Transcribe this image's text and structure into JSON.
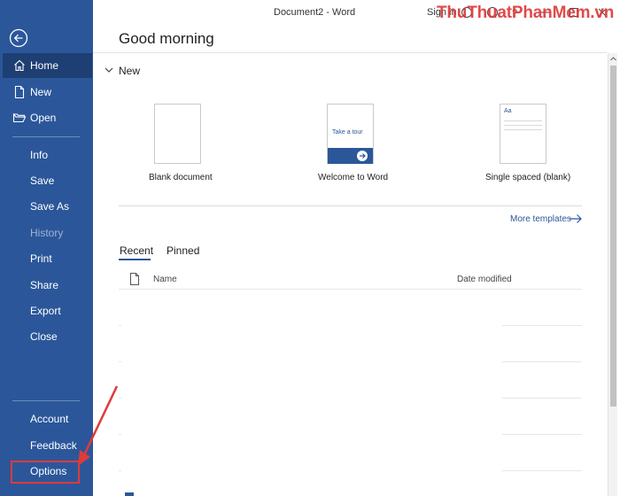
{
  "window": {
    "title": "Document2  -  Word",
    "sign_in": "Sign in",
    "watermark": "ThuThuatPhanMem.vn"
  },
  "sidebar": {
    "items": [
      {
        "label": "Home",
        "icon": "home-icon"
      },
      {
        "label": "New",
        "icon": "new-document-icon"
      },
      {
        "label": "Open",
        "icon": "open-folder-icon"
      },
      {
        "label": "Info"
      },
      {
        "label": "Save"
      },
      {
        "label": "Save As"
      },
      {
        "label": "History"
      },
      {
        "label": "Print"
      },
      {
        "label": "Share"
      },
      {
        "label": "Export"
      },
      {
        "label": "Close"
      },
      {
        "label": "Account"
      },
      {
        "label": "Feedback"
      },
      {
        "label": "Options"
      }
    ],
    "active": "Home",
    "disabled": [
      "History"
    ],
    "highlight_color": "#e03a3a"
  },
  "main": {
    "greeting": "Good morning",
    "new_section": {
      "title": "New",
      "templates": [
        {
          "caption": "Blank document"
        },
        {
          "caption": "Welcome to Word",
          "thumb_text": "Take a tour"
        },
        {
          "caption": "Single spaced (blank)",
          "thumb_text": "Aa"
        }
      ],
      "more_templates": "More templates"
    },
    "recent": {
      "tabs": [
        "Recent",
        "Pinned"
      ],
      "active_tab": "Recent",
      "columns": {
        "name": "Name",
        "date": "Date modified"
      }
    }
  },
  "colors": {
    "brand": "#2b579a",
    "accent_dark": "#1e3f73",
    "annotation": "#e03a3a"
  }
}
